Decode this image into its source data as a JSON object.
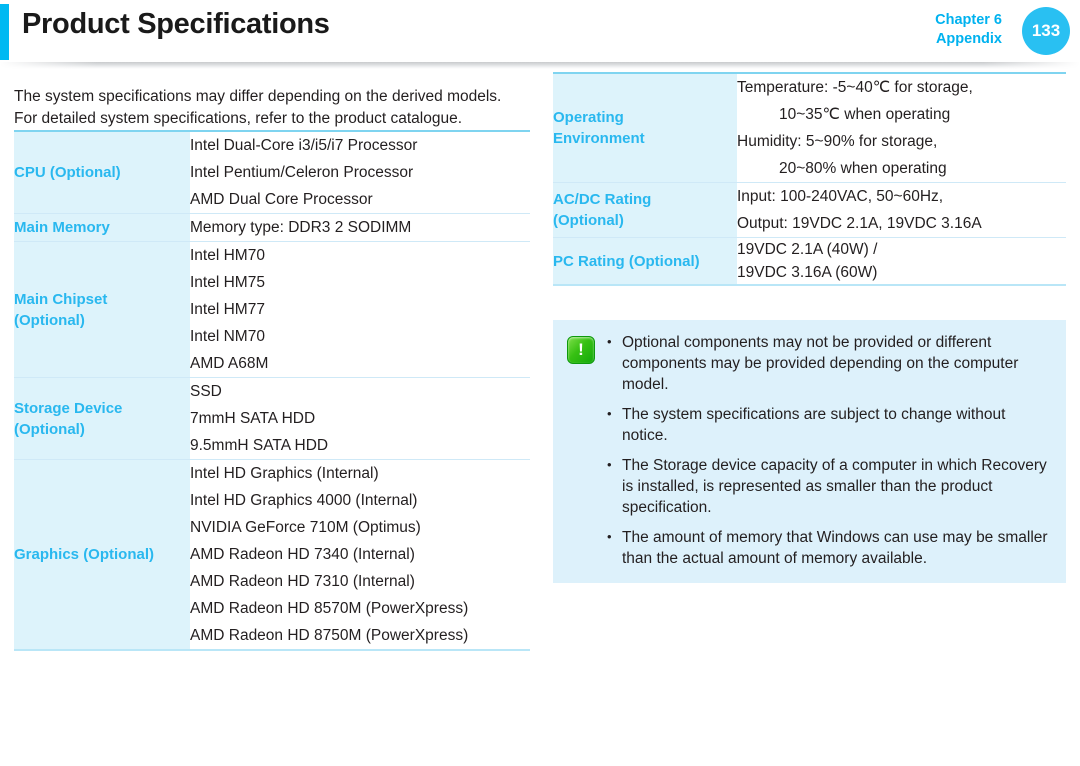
{
  "header": {
    "title": "Product Specifications",
    "chapter": "Chapter 6",
    "section": "Appendix",
    "page_number": "133"
  },
  "intro": {
    "line1": "The system specifications may differ depending on the derived models.",
    "line2": "For detailed system specifications, refer to the product catalogue."
  },
  "left_table": {
    "rows": [
      {
        "label_line1": "CPU (Optional)",
        "label_line2": "",
        "values": [
          "Intel Dual-Core i3/i5/i7 Processor",
          "Intel Pentium/Celeron Processor",
          "AMD Dual Core Processor"
        ]
      },
      {
        "label_line1": "Main Memory",
        "label_line2": "",
        "values": [
          "Memory type: DDR3 2 SODIMM"
        ]
      },
      {
        "label_line1": "Main Chipset",
        "label_line2": "(Optional)",
        "values": [
          "Intel HM70",
          "Intel HM75",
          "Intel HM77",
          "Intel NM70",
          "AMD A68M"
        ]
      },
      {
        "label_line1": "Storage Device",
        "label_line2": "(Optional)",
        "values": [
          "SSD",
          "7mmH SATA HDD",
          "9.5mmH SATA HDD"
        ]
      },
      {
        "label_line1": "Graphics (Optional)",
        "label_line2": "",
        "values": [
          "Intel HD Graphics (Internal)",
          "Intel HD Graphics 4000 (Internal)",
          "NVIDIA GeForce 710M (Optimus)",
          "AMD Radeon HD 7340 (Internal)",
          "AMD Radeon HD 7310 (Internal)",
          "AMD Radeon HD 8570M (PowerXpress)",
          "AMD Radeon HD 8750M (PowerXpress)"
        ]
      }
    ]
  },
  "right_table": {
    "rows": [
      {
        "label_line1": "Operating",
        "label_line2": "Environment",
        "values": [
          "Temperature: -5~40℃ for storage,",
          "10~35℃ when operating",
          "Humidity: 5~90% for storage,",
          "20~80% when operating"
        ],
        "indent_flags": [
          false,
          true,
          false,
          true
        ]
      },
      {
        "label_line1": "AC/DC Rating",
        "label_line2": "(Optional)",
        "values": [
          "Input: 100-240VAC, 50~60Hz,",
          "Output: 19VDC 2.1A, 19VDC 3.16A"
        ],
        "indent_flags": [
          false,
          false
        ]
      },
      {
        "label_line1": "PC Rating (Optional)",
        "label_line2": "",
        "values": [
          "19VDC 2.1A (40W) /",
          "19VDC 3.16A (60W)"
        ],
        "indent_flags": [
          false,
          false
        ]
      }
    ]
  },
  "note": {
    "icon": "exclamation-icon",
    "items": [
      "Optional components may not be provided or different components may be provided depending on the computer model.",
      "The system specifications are subject to change without notice.",
      "The Storage device capacity of a computer in which Recovery is installed, is represented as smaller than the product specification.",
      "The amount of memory that Windows can use may be smaller than the actual amount of memory available."
    ]
  },
  "colors": {
    "accent": "#00b9f2",
    "label_text": "#29b8ef",
    "label_bg": "#ddf3fb",
    "note_bg": "#ddf1fb",
    "note_icon": "#37c013"
  }
}
